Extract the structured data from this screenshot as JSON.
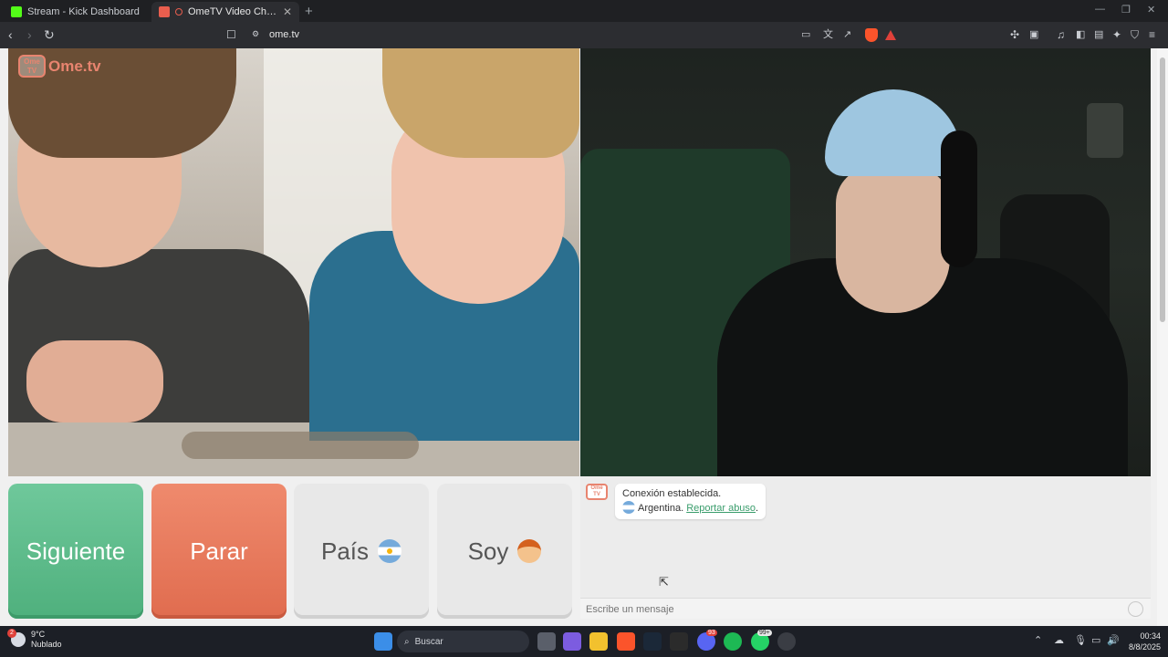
{
  "browser": {
    "tabs": [
      {
        "title": "Stream - Kick Dashboard"
      },
      {
        "title": "OmeTV Video Chat — Omegle"
      }
    ],
    "url": "ome.tv"
  },
  "logo": {
    "badge": "Ome TV",
    "text": "Ome.tv"
  },
  "actions": {
    "next": "Siguiente",
    "stop": "Parar",
    "country": "País",
    "gender": "Soy"
  },
  "chat": {
    "logo": "Ome TV",
    "status": "Conexión establecida.",
    "country": "Argentina.",
    "report": "Reportar abuso",
    "report_suffix": ".",
    "placeholder": "Escribe un mensaje"
  },
  "taskbar": {
    "weather_temp": "9°C",
    "weather_desc": "Nublado",
    "weather_badge": "2",
    "search": "Buscar",
    "discord_badge": "93",
    "whatsapp_badge": "99+",
    "time": "00:34",
    "date": "8/8/2025"
  },
  "colors": {
    "next": "#5dbd8c",
    "stop": "#e8775b",
    "accent_link": "#3a9d6c"
  }
}
